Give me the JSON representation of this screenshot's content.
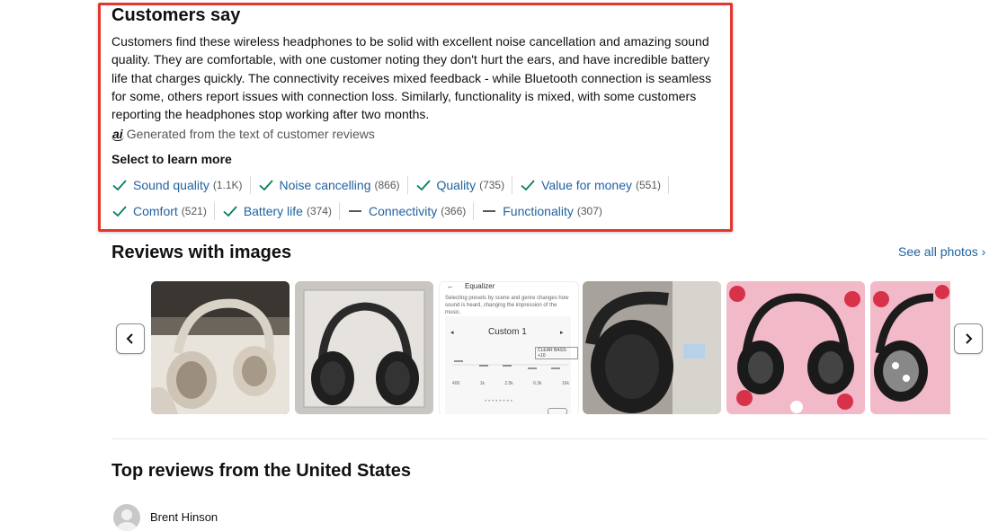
{
  "customers_say": {
    "title": "Customers say",
    "summary": "Customers find these wireless headphones to be solid with excellent noise cancellation and amazing sound quality. They are comfortable, with one customer noting they don't hurt the ears, and have incredible battery life that charges quickly. The connectivity receives mixed feedback - while Bluetooth connection is seamless for some, others report issues with connection loss. Similarly, functionality is mixed, with some customers reporting the headphones stop working after two months.",
    "ai_icon": "ai",
    "generated_note": "Generated from the text of customer reviews",
    "learn_label": "Select to learn more",
    "aspects_row1": [
      {
        "label": "Sound quality",
        "count": "(1.1K)",
        "sentiment": "positive"
      },
      {
        "label": "Noise cancelling",
        "count": "(866)",
        "sentiment": "positive"
      },
      {
        "label": "Quality",
        "count": "(735)",
        "sentiment": "positive"
      },
      {
        "label": "Value for money",
        "count": "(551)",
        "sentiment": "positive"
      }
    ],
    "aspects_row2": [
      {
        "label": "Comfort",
        "count": "(521)",
        "sentiment": "positive"
      },
      {
        "label": "Battery life",
        "count": "(374)",
        "sentiment": "positive"
      },
      {
        "label": "Connectivity",
        "count": "(366)",
        "sentiment": "mixed"
      },
      {
        "label": "Functionality",
        "count": "(307)",
        "sentiment": "mixed"
      }
    ]
  },
  "reviews_with_images": {
    "title": "Reviews with images",
    "see_all": "See all photos ›",
    "prev_icon": "chevron-left-icon",
    "next_icon": "chevron-right-icon",
    "equalizer_screen": {
      "title": "Equalizer",
      "description": "Selecting presets by scene and genre changes how sound is heard, changing the impression of the music.",
      "preset": "Custom 1",
      "clear_bass": "CLEAR BASS: +10",
      "bands": [
        "400",
        "1k",
        "2.5k",
        "6.3k",
        "16k"
      ]
    }
  },
  "top_reviews": {
    "title": "Top reviews from the United States",
    "reviewer": "Brent Hinson"
  },
  "colors": {
    "link": "#2162a1",
    "highlight": "#e3382f",
    "muted": "#565959"
  }
}
